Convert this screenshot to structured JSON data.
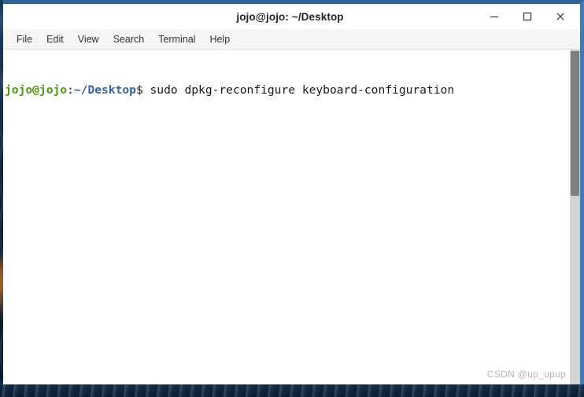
{
  "window": {
    "title": "jojo@jojo: ~/Desktop",
    "controls": {
      "minimize_label": "Minimize",
      "maximize_label": "Maximize",
      "close_label": "Close"
    }
  },
  "menubar": {
    "items": [
      {
        "label": "File"
      },
      {
        "label": "Edit"
      },
      {
        "label": "View"
      },
      {
        "label": "Search"
      },
      {
        "label": "Terminal"
      },
      {
        "label": "Help"
      }
    ]
  },
  "terminal": {
    "lines": [
      {
        "user_host": "jojo@jojo",
        "separator": ":",
        "path": "~/Desktop",
        "command": "$ sudo dpkg-reconfigure keyboard-configuration"
      }
    ],
    "colors": {
      "user_host": "#4e9a06",
      "path": "#3465a4",
      "text": "#1a1a1a",
      "background": "#ffffff"
    }
  },
  "scrollbar": {
    "track_color": "#d3d3d3",
    "thumb_color": "#7e7e7e"
  },
  "frame": {
    "top_border_color": "#2f6699",
    "side_border_color": "#3d7cba"
  },
  "watermark": {
    "text": "CSDN @up_upup"
  }
}
